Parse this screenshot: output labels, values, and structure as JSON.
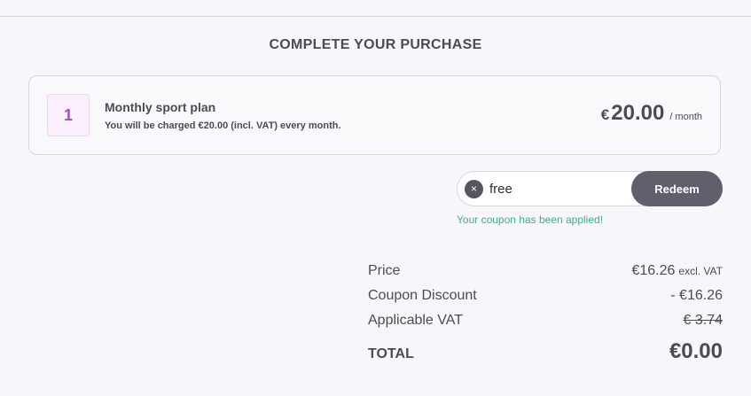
{
  "page": {
    "title": "COMPLETE YOUR PURCHASE"
  },
  "plan": {
    "badge": "1",
    "name": "Monthly sport plan",
    "description": "You will be charged €20.00 (incl. VAT) every month.",
    "currency": "€",
    "amount": "20.00",
    "period": "/ month"
  },
  "coupon": {
    "value": "free",
    "clear_icon": "×",
    "redeem_label": "Redeem",
    "message": "Your coupon has been applied!"
  },
  "summary": {
    "price_label": "Price",
    "price_value": "€16.26",
    "price_note": "excl. VAT",
    "discount_label": "Coupon Discount",
    "discount_value": "- €16.26",
    "vat_label": "Applicable VAT",
    "vat_value": "€ 3.74",
    "total_label": "TOTAL",
    "total_value": "€0.00"
  },
  "colors": {
    "accent": "#a24fbd",
    "success": "#3fae8a",
    "button": "#5f606b",
    "text": "#4a4b53"
  }
}
